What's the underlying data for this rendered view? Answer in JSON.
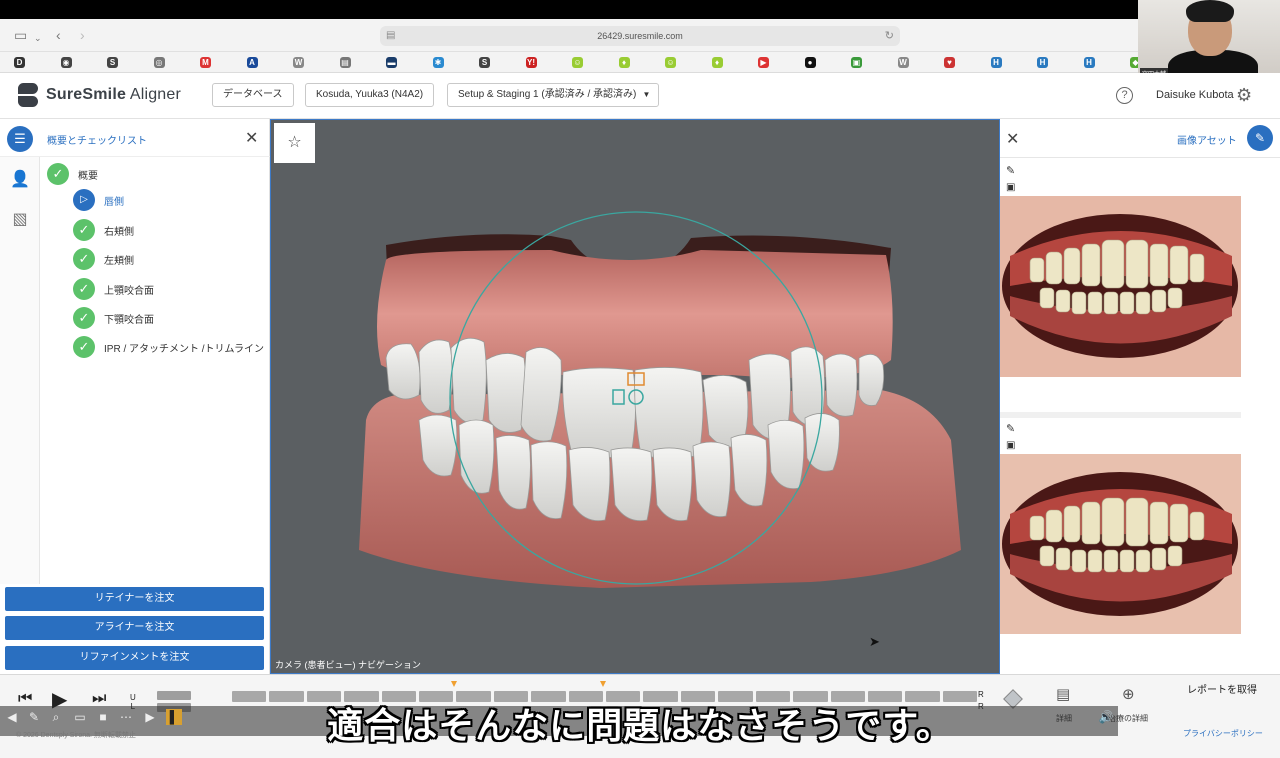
{
  "browser": {
    "url": "26429.suresmile.com",
    "bookmarks": [
      "D",
      "◉",
      "S",
      "◎",
      "M",
      "A",
      "W",
      "▤",
      "▬",
      "✱",
      "S",
      "Y!",
      "☺",
      "♦",
      "☺",
      "♦",
      "▶",
      "●",
      "▣",
      "W",
      "♥",
      "H",
      "H",
      "H",
      "◆"
    ]
  },
  "webcam": {
    "name_tag": "窪田大輔"
  },
  "header": {
    "brand_bold": "SureSmile",
    "brand_light": " Aligner",
    "database_btn": "データベース",
    "patient_btn": "Kosuda, Yuuka3 (N4A2)",
    "setup_btn": "Setup & Staging 1 (承認済み / 承認済み)",
    "user_name": "Daisuke Kubota"
  },
  "left_panel": {
    "title": "概要とチェックリスト",
    "checklist": [
      {
        "label": "概要",
        "state": "done"
      },
      {
        "label": "唇側",
        "state": "current"
      },
      {
        "label": "右頬側",
        "state": "done"
      },
      {
        "label": "左頬側",
        "state": "done"
      },
      {
        "label": "上顎咬合面",
        "state": "done"
      },
      {
        "label": "下顎咬合面",
        "state": "done"
      },
      {
        "label": "IPR / アタッチメント /トリムライン",
        "state": "done"
      }
    ],
    "order_retainer": "リテイナーを注文",
    "order_aligner": "アライナーを注文",
    "order_refinement": "リファインメントを注文"
  },
  "viewer": {
    "camera_label": "カメラ (患者ビュー) ナビゲーション"
  },
  "right_panel": {
    "title": "画像アセット"
  },
  "bottom": {
    "report_btn": "レポートを取得",
    "detail_label": "詳細",
    "compare_label": "治療の詳細",
    "privacy": "プライバシーポリシー",
    "copyright": "© 2026 Dentsply Sirona. 無断転載禁止",
    "caption": "適合はそんなに問題はなさそうです。",
    "r_label": "R",
    "u_label": "U",
    "l_label": "L"
  },
  "colors": {
    "accent": "#2a6fc0",
    "check": "#5cc26a",
    "viewer_bg": "#5b5f62"
  }
}
